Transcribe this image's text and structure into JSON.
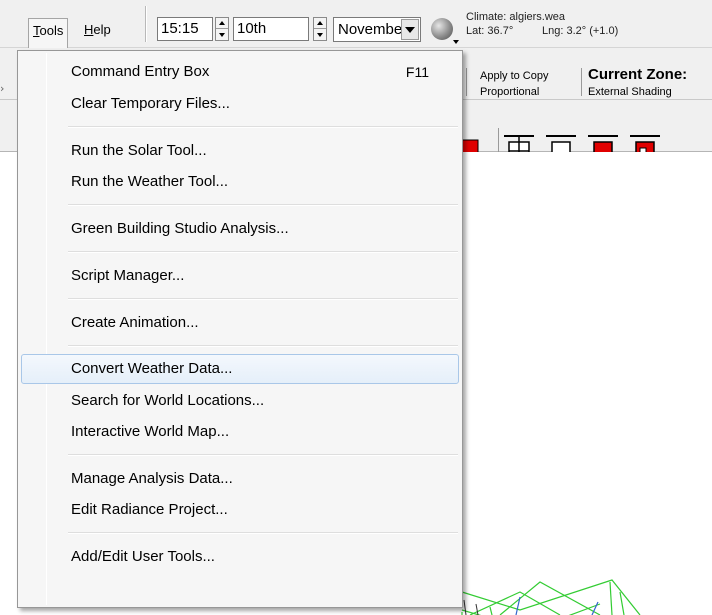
{
  "menubar": {
    "tools": {
      "accel": "T",
      "rest": "ools"
    },
    "help": {
      "accel": "H",
      "rest": "elp"
    }
  },
  "time_controls": {
    "time": "15:15",
    "day": "10th",
    "month": "November"
  },
  "climate": {
    "file": "Climate: algiers.wea",
    "lat": "Lat: 36.7°",
    "lng": "Lng: 3.2° (+1.0)"
  },
  "row2": {
    "apply_to_copy": "Apply to Copy",
    "proportional": "Proportional",
    "current_zone": "Current Zone:",
    "external_shading": "External Shading"
  },
  "colors": {
    "menu_bg": "#f6f6f6",
    "highlight_border": "#a9c7e8",
    "wireframe_green": "#33cc33",
    "wireframe_blue": "#3366cc",
    "icon_red": "#e00000"
  },
  "tools_menu": {
    "items": [
      {
        "label": "Command Entry Box",
        "shortcut": "F11"
      },
      {
        "label": "Clear Temporary Files..."
      },
      {
        "label": "Run the Solar Tool..."
      },
      {
        "label": "Run the Weather Tool..."
      },
      {
        "label": "Green Building Studio Analysis..."
      },
      {
        "label": "Script Manager..."
      },
      {
        "label": "Create Animation..."
      },
      {
        "label": "Convert Weather Data..."
      },
      {
        "label": "Search for World Locations..."
      },
      {
        "label": "Interactive World Map..."
      },
      {
        "label": "Manage Analysis Data..."
      },
      {
        "label": "Edit Radiance Project..."
      },
      {
        "label": "Add/Edit User Tools..."
      }
    ],
    "highlighted": "Convert Weather Data..."
  }
}
